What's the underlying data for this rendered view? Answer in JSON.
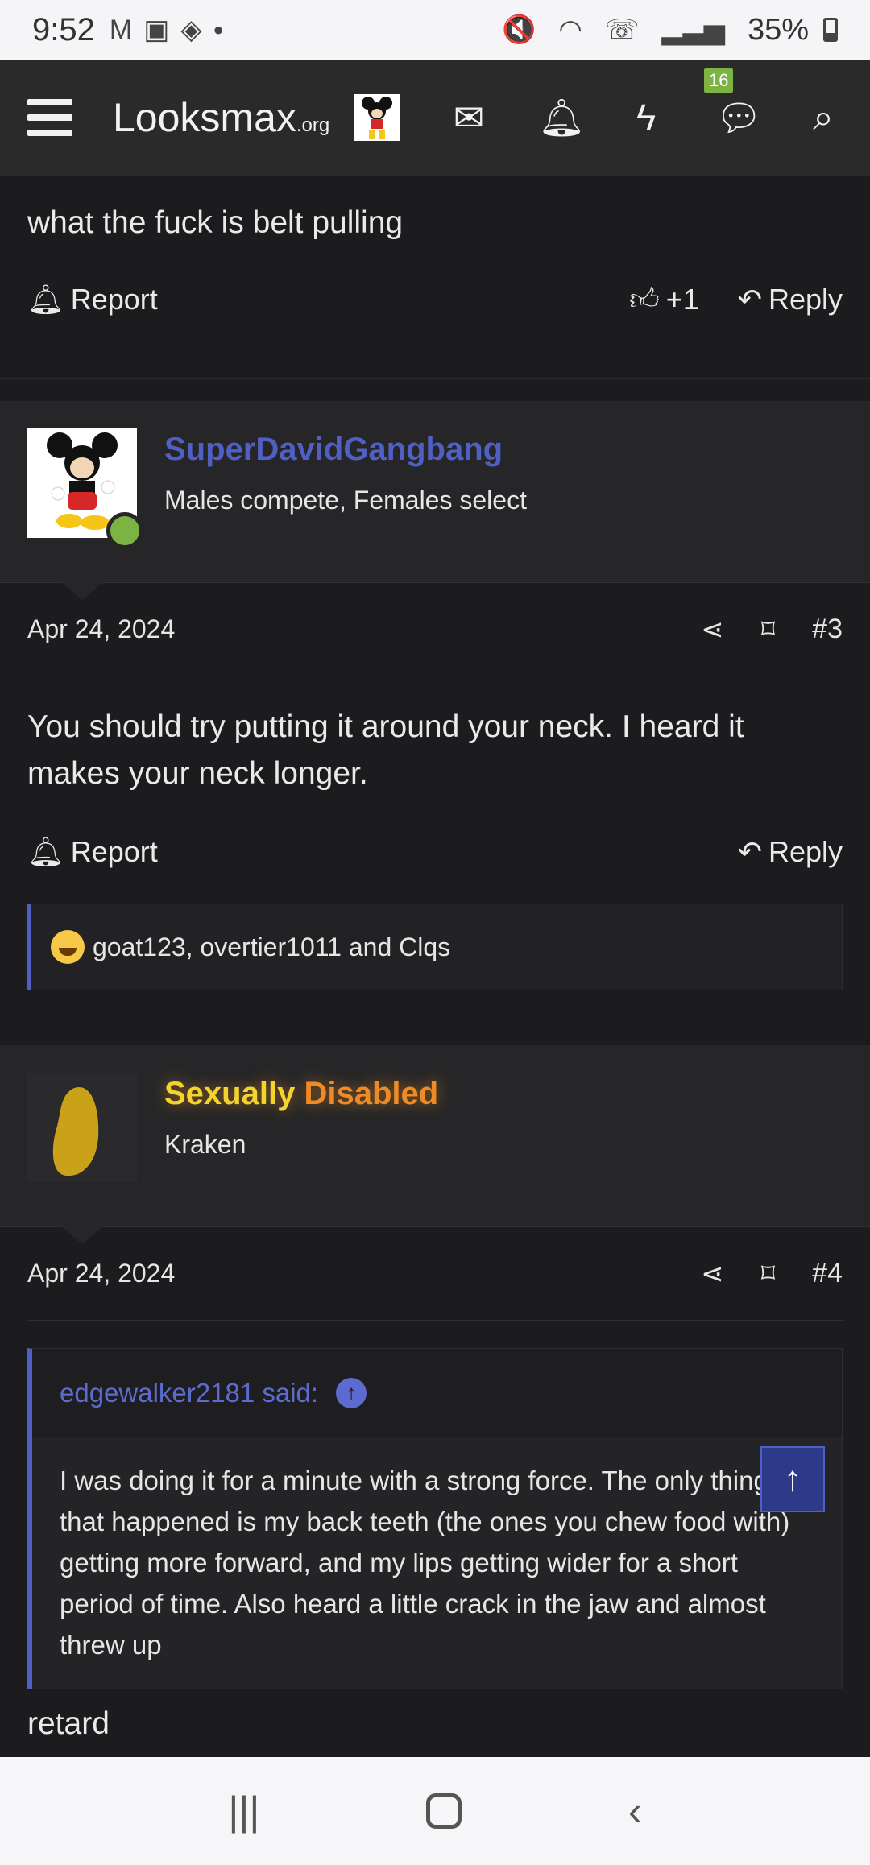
{
  "status_bar": {
    "time": "9:52",
    "battery": "35%",
    "left_icons": [
      "gmail-icon",
      "photos-icon",
      "app-icon",
      "dot-icon"
    ],
    "right_icons": [
      "mute-icon",
      "wifi-6e-icon",
      "wifi-calling-icon",
      "signal-icon",
      "battery-icon"
    ]
  },
  "nav": {
    "logo_main": "Looksmax",
    "logo_suffix": ".org",
    "chat_badge": "16"
  },
  "post2_tail": {
    "text": "what the fuck is belt pulling",
    "report": "Report",
    "like_count": "+1",
    "reply": "Reply"
  },
  "post3": {
    "username": "SuperDavidGangbang",
    "user_title": "Males compete, Females select",
    "date": "Apr 24, 2024",
    "number": "#3",
    "body": "You should try putting it around your neck. I heard it makes your neck longer.",
    "report": "Report",
    "reply": "Reply",
    "reactions_text": "goat123, overtier1011 and Clqs"
  },
  "post4": {
    "username_part1": "Sexually",
    "username_part2": "Disabled",
    "user_title": "Kraken",
    "date": "Apr 24, 2024",
    "number": "#4",
    "quote_author": "edgewalker2181 said:",
    "quote_body": "I was doing it for a minute with a strong force. The only thing that happened is my back teeth (the ones you chew food with) getting more forward, and my lips getting wider for a short period of time. Also heard a little crack in the jaw and almost threw up",
    "body": "retard"
  },
  "colors": {
    "accent": "#4f5fc4",
    "online": "#7cb342",
    "bg": "#1c1c1e",
    "gold": "#f3d32c",
    "orange": "#f08a24"
  }
}
